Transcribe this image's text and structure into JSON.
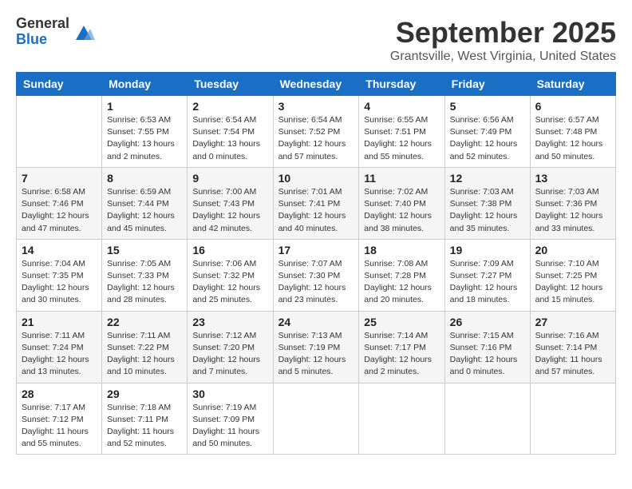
{
  "logo": {
    "general": "General",
    "blue": "Blue"
  },
  "header": {
    "month": "September 2025",
    "location": "Grantsville, West Virginia, United States"
  },
  "days_of_week": [
    "Sunday",
    "Monday",
    "Tuesday",
    "Wednesday",
    "Thursday",
    "Friday",
    "Saturday"
  ],
  "weeks": [
    [
      {
        "day": "",
        "info": ""
      },
      {
        "day": "1",
        "info": "Sunrise: 6:53 AM\nSunset: 7:55 PM\nDaylight: 13 hours\nand 2 minutes."
      },
      {
        "day": "2",
        "info": "Sunrise: 6:54 AM\nSunset: 7:54 PM\nDaylight: 13 hours\nand 0 minutes."
      },
      {
        "day": "3",
        "info": "Sunrise: 6:54 AM\nSunset: 7:52 PM\nDaylight: 12 hours\nand 57 minutes."
      },
      {
        "day": "4",
        "info": "Sunrise: 6:55 AM\nSunset: 7:51 PM\nDaylight: 12 hours\nand 55 minutes."
      },
      {
        "day": "5",
        "info": "Sunrise: 6:56 AM\nSunset: 7:49 PM\nDaylight: 12 hours\nand 52 minutes."
      },
      {
        "day": "6",
        "info": "Sunrise: 6:57 AM\nSunset: 7:48 PM\nDaylight: 12 hours\nand 50 minutes."
      }
    ],
    [
      {
        "day": "7",
        "info": "Sunrise: 6:58 AM\nSunset: 7:46 PM\nDaylight: 12 hours\nand 47 minutes."
      },
      {
        "day": "8",
        "info": "Sunrise: 6:59 AM\nSunset: 7:44 PM\nDaylight: 12 hours\nand 45 minutes."
      },
      {
        "day": "9",
        "info": "Sunrise: 7:00 AM\nSunset: 7:43 PM\nDaylight: 12 hours\nand 42 minutes."
      },
      {
        "day": "10",
        "info": "Sunrise: 7:01 AM\nSunset: 7:41 PM\nDaylight: 12 hours\nand 40 minutes."
      },
      {
        "day": "11",
        "info": "Sunrise: 7:02 AM\nSunset: 7:40 PM\nDaylight: 12 hours\nand 38 minutes."
      },
      {
        "day": "12",
        "info": "Sunrise: 7:03 AM\nSunset: 7:38 PM\nDaylight: 12 hours\nand 35 minutes."
      },
      {
        "day": "13",
        "info": "Sunrise: 7:03 AM\nSunset: 7:36 PM\nDaylight: 12 hours\nand 33 minutes."
      }
    ],
    [
      {
        "day": "14",
        "info": "Sunrise: 7:04 AM\nSunset: 7:35 PM\nDaylight: 12 hours\nand 30 minutes."
      },
      {
        "day": "15",
        "info": "Sunrise: 7:05 AM\nSunset: 7:33 PM\nDaylight: 12 hours\nand 28 minutes."
      },
      {
        "day": "16",
        "info": "Sunrise: 7:06 AM\nSunset: 7:32 PM\nDaylight: 12 hours\nand 25 minutes."
      },
      {
        "day": "17",
        "info": "Sunrise: 7:07 AM\nSunset: 7:30 PM\nDaylight: 12 hours\nand 23 minutes."
      },
      {
        "day": "18",
        "info": "Sunrise: 7:08 AM\nSunset: 7:28 PM\nDaylight: 12 hours\nand 20 minutes."
      },
      {
        "day": "19",
        "info": "Sunrise: 7:09 AM\nSunset: 7:27 PM\nDaylight: 12 hours\nand 18 minutes."
      },
      {
        "day": "20",
        "info": "Sunrise: 7:10 AM\nSunset: 7:25 PM\nDaylight: 12 hours\nand 15 minutes."
      }
    ],
    [
      {
        "day": "21",
        "info": "Sunrise: 7:11 AM\nSunset: 7:24 PM\nDaylight: 12 hours\nand 13 minutes."
      },
      {
        "day": "22",
        "info": "Sunrise: 7:11 AM\nSunset: 7:22 PM\nDaylight: 12 hours\nand 10 minutes."
      },
      {
        "day": "23",
        "info": "Sunrise: 7:12 AM\nSunset: 7:20 PM\nDaylight: 12 hours\nand 7 minutes."
      },
      {
        "day": "24",
        "info": "Sunrise: 7:13 AM\nSunset: 7:19 PM\nDaylight: 12 hours\nand 5 minutes."
      },
      {
        "day": "25",
        "info": "Sunrise: 7:14 AM\nSunset: 7:17 PM\nDaylight: 12 hours\nand 2 minutes."
      },
      {
        "day": "26",
        "info": "Sunrise: 7:15 AM\nSunset: 7:16 PM\nDaylight: 12 hours\nand 0 minutes."
      },
      {
        "day": "27",
        "info": "Sunrise: 7:16 AM\nSunset: 7:14 PM\nDaylight: 11 hours\nand 57 minutes."
      }
    ],
    [
      {
        "day": "28",
        "info": "Sunrise: 7:17 AM\nSunset: 7:12 PM\nDaylight: 11 hours\nand 55 minutes."
      },
      {
        "day": "29",
        "info": "Sunrise: 7:18 AM\nSunset: 7:11 PM\nDaylight: 11 hours\nand 52 minutes."
      },
      {
        "day": "30",
        "info": "Sunrise: 7:19 AM\nSunset: 7:09 PM\nDaylight: 11 hours\nand 50 minutes."
      },
      {
        "day": "",
        "info": ""
      },
      {
        "day": "",
        "info": ""
      },
      {
        "day": "",
        "info": ""
      },
      {
        "day": "",
        "info": ""
      }
    ]
  ]
}
